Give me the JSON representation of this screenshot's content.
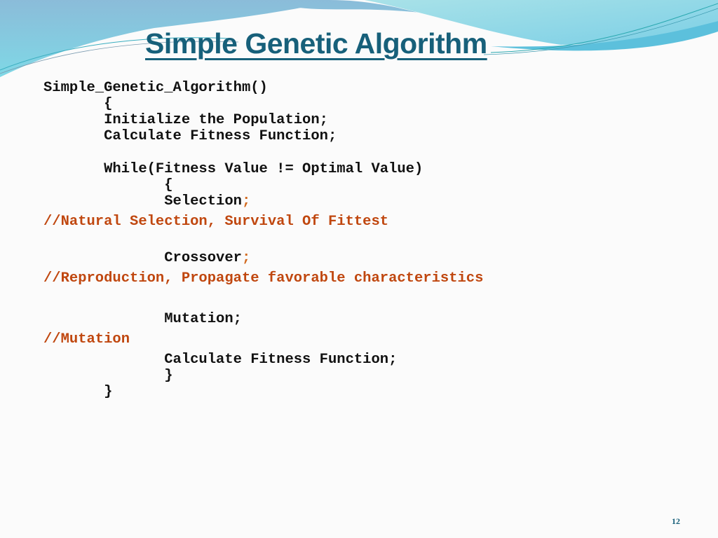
{
  "slide": {
    "title": "Simple Genetic Algorithm",
    "page_number": "12",
    "colors": {
      "title": "#17607a",
      "code": "#111111",
      "comment": "#c0470f",
      "wave_light": "#7fd3e3",
      "wave_blue": "#8ebfdc"
    }
  },
  "code": {
    "lines": [
      {
        "text": "Simple_Genetic_Algorithm()",
        "type": "code"
      },
      {
        "text": "       {",
        "type": "code"
      },
      {
        "text": "       Initialize the Population;",
        "type": "code"
      },
      {
        "text": "       Calculate Fitness Function;",
        "type": "code"
      },
      {
        "text": "       While(Fitness Value != Optimal Value)",
        "type": "code"
      },
      {
        "text": "              {",
        "type": "code"
      },
      {
        "text": "              Selection",
        "type": "code",
        "suffix": ";"
      },
      {
        "text": "//Natural Selection, Survival Of Fittest",
        "type": "comment"
      },
      {
        "text": "              Crossover",
        "type": "code",
        "suffix": ";"
      },
      {
        "text": "//Reproduction, Propagate favorable characteristics",
        "type": "comment"
      },
      {
        "text": "              Mutation;",
        "type": "code"
      },
      {
        "text": "//Mutation",
        "type": "comment"
      },
      {
        "text": "              Calculate Fitness Function;",
        "type": "code"
      },
      {
        "text": "              }",
        "type": "code"
      },
      {
        "text": "       }",
        "type": "code"
      }
    ]
  }
}
